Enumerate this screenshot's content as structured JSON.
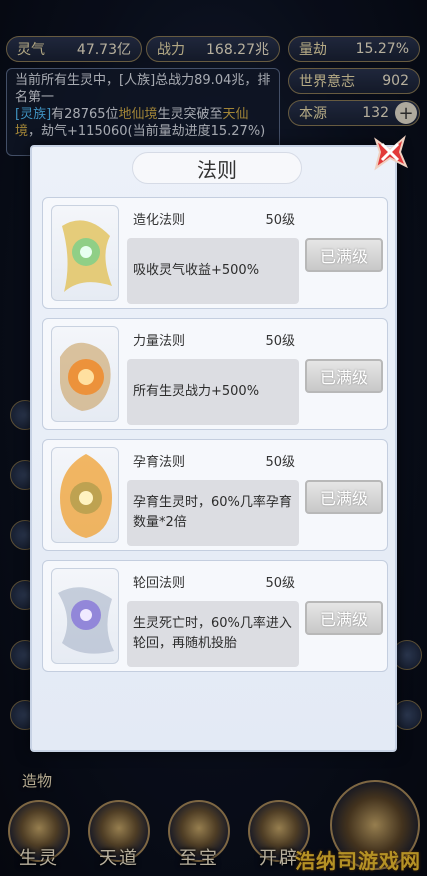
{
  "resources": {
    "lingqi": {
      "label": "灵气",
      "value": "47.73亿"
    },
    "zhanli": {
      "label": "战力",
      "value": "168.27兆"
    },
    "liangjie": {
      "label": "量劫",
      "value": "15.27%"
    },
    "shijie": {
      "label": "世界意志",
      "value": "902"
    },
    "benyuan": {
      "label": "本源",
      "value": "132"
    }
  },
  "notice": {
    "line1": "当前所有生灵中，[人族]总战力89.04兆，排名第一",
    "tag": "[灵族]",
    "line2a": "有28765位",
    "realm1": "地仙境",
    "line2b": "生灵突破至",
    "realm2": "天仙境",
    "line3": "，劫气+115060(当前量劫进度15.27%)"
  },
  "modal": {
    "title": "法则",
    "cards": [
      {
        "name": "造化法则",
        "level": "50级",
        "desc": "吸收灵气收益+500%",
        "button": "已满级",
        "accent": "#7ad08a"
      },
      {
        "name": "力量法则",
        "level": "50级",
        "desc": "所有生灵战力+500%",
        "button": "已满级",
        "accent": "#f08a2a"
      },
      {
        "name": "孕育法则",
        "level": "50级",
        "desc": "孕育生灵时，60%几率孕育数量*2倍",
        "button": "已满级",
        "accent": "#f0a030"
      },
      {
        "name": "轮回法则",
        "level": "50级",
        "desc": "生灵死亡时，60%几率进入轮回，再随机投胎",
        "button": "已满级",
        "accent": "#8a7ad8"
      }
    ]
  },
  "left_label": "造物",
  "nav": [
    "生灵",
    "天道",
    "至宝",
    "开辟"
  ],
  "watermark": "浩纳司游戏网"
}
